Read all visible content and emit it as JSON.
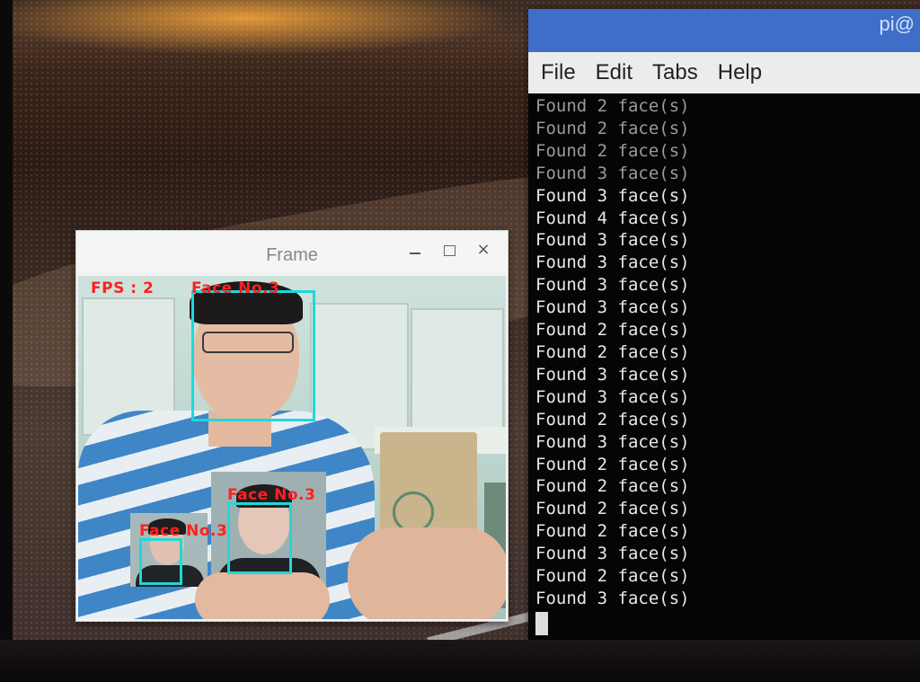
{
  "terminal": {
    "title": "pi@",
    "menu": [
      "File",
      "Edit",
      "Tabs",
      "Help"
    ],
    "lines": [
      "Found 2 face(s)",
      "Found 2 face(s)",
      "Found 2 face(s)",
      "Found 3 face(s)",
      "Found 3 face(s)",
      "Found 4 face(s)",
      "Found 3 face(s)",
      "Found 3 face(s)",
      "Found 3 face(s)",
      "Found 3 face(s)",
      "Found 2 face(s)",
      "Found 2 face(s)",
      "Found 3 face(s)",
      "Found 3 face(s)",
      "Found 2 face(s)",
      "Found 3 face(s)",
      "Found 2 face(s)",
      "Found 2 face(s)",
      "Found 2 face(s)",
      "Found 2 face(s)",
      "Found 3 face(s)",
      "Found 2 face(s)",
      "Found 3 face(s)"
    ]
  },
  "frame_window": {
    "title": "Frame",
    "minimize_icon": "minimize-icon",
    "maximize_icon": "maximize-icon",
    "close_icon": "close-icon",
    "close_glyph": "×",
    "overlay": {
      "fps_text": "FPS : 2",
      "face_labels": [
        "Face No.3",
        "Face No.3",
        "Face No.3"
      ],
      "label_color": "#ff2020",
      "box_color": "#20d8d8"
    }
  },
  "colors": {
    "terminal_titlebar": "#3f6ec8",
    "terminal_bg": "#050505",
    "terminal_text": "#e8e8e8"
  }
}
